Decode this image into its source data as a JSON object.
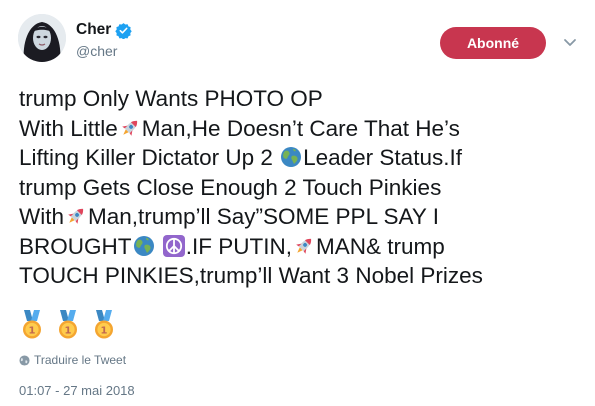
{
  "header": {
    "display_name": "Cher",
    "handle": "@cher",
    "verified_icon": "verified-badge-icon",
    "follow_button_label": "Abonné",
    "menu_icon": "chevron-down-icon",
    "accent_color": "#c8364f",
    "verified_color": "#1da1f2"
  },
  "tweet": {
    "lines": [
      {
        "a": "trump Only Wants PHOTO OP"
      },
      {
        "a": "With Little",
        "b": "Man,He Doesn’t Care That He’s"
      },
      {
        "a": "Lifting Killer Dictator Up 2 ",
        "b": "Leader Status.If"
      },
      {
        "a": "trump Gets Close Enough 2 Touch Pinkies"
      },
      {
        "a": "With",
        "b": "Man,trump’ll Say”SOME PPL SAY I"
      },
      {
        "a": "BROUGHT",
        "b": ".IF PUTIN,",
        "c": "MAN& trump"
      },
      {
        "a": "TOUCH PINKIES,trump’ll Want 3 Nobel Prizes"
      }
    ],
    "emoji_icons": [
      "rocket-icon",
      "earth-globe-icon",
      "peace-symbol-icon",
      "gold-medal-icon"
    ]
  },
  "footer": {
    "translate_label": "Traduire le Tweet",
    "timestamp": "01:07 - 27 mai 2018"
  }
}
